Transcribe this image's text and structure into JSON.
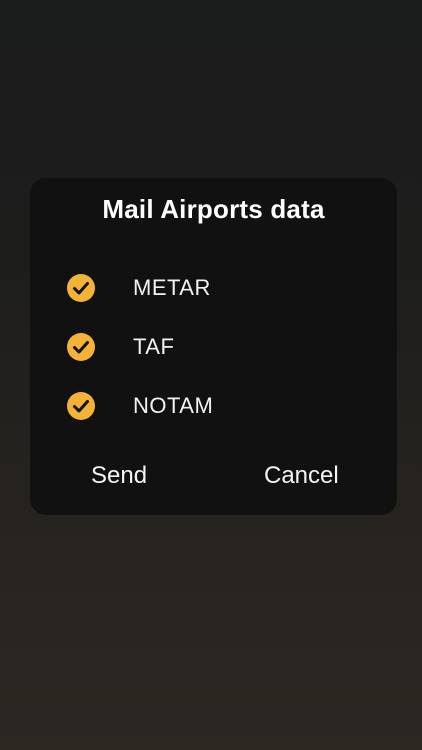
{
  "dialog": {
    "title": "Mail Airports data",
    "options": [
      {
        "label": "METAR",
        "checked": true,
        "icon": "check-circle-icon"
      },
      {
        "label": "TAF",
        "checked": true,
        "icon": "check-circle-icon"
      },
      {
        "label": "NOTAM",
        "checked": true,
        "icon": "check-circle-icon"
      }
    ],
    "send_label": "Send",
    "cancel_label": "Cancel"
  },
  "colors": {
    "accent": "#F5B335",
    "dialog_bg": "#111111",
    "text": "#FFFFFF"
  }
}
